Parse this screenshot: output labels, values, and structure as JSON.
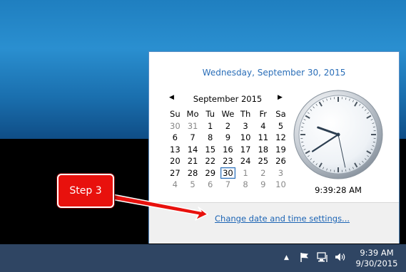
{
  "popup": {
    "date_heading": "Wednesday, September 30, 2015",
    "month_label": "September 2015",
    "prev_symbol": "◀",
    "next_symbol": "▶",
    "weekdays": [
      "Su",
      "Mo",
      "Tu",
      "We",
      "Th",
      "Fr",
      "Sa"
    ],
    "weeks": [
      [
        "30",
        "31",
        "1",
        "2",
        "3",
        "4",
        "5"
      ],
      [
        "6",
        "7",
        "8",
        "9",
        "10",
        "11",
        "12"
      ],
      [
        "13",
        "14",
        "15",
        "16",
        "17",
        "18",
        "19"
      ],
      [
        "20",
        "21",
        "22",
        "23",
        "24",
        "25",
        "26"
      ],
      [
        "27",
        "28",
        "29",
        "30",
        "1",
        "2",
        "3"
      ],
      [
        "4",
        "5",
        "6",
        "7",
        "8",
        "9",
        "10"
      ]
    ],
    "selected_day": "30",
    "time_label": "9:39:28 AM",
    "clock": {
      "hour": 9,
      "minute": 39,
      "second": 28
    },
    "settings_link": "Change date and time settings..."
  },
  "annotation": {
    "label": "Step 3",
    "color": "#e8110d"
  },
  "taskbar": {
    "tray_overflow_symbol": "▲",
    "time": "9:39 AM",
    "date": "9/30/2015",
    "icons": [
      "flag-icon",
      "network-icon",
      "volume-icon"
    ]
  }
}
